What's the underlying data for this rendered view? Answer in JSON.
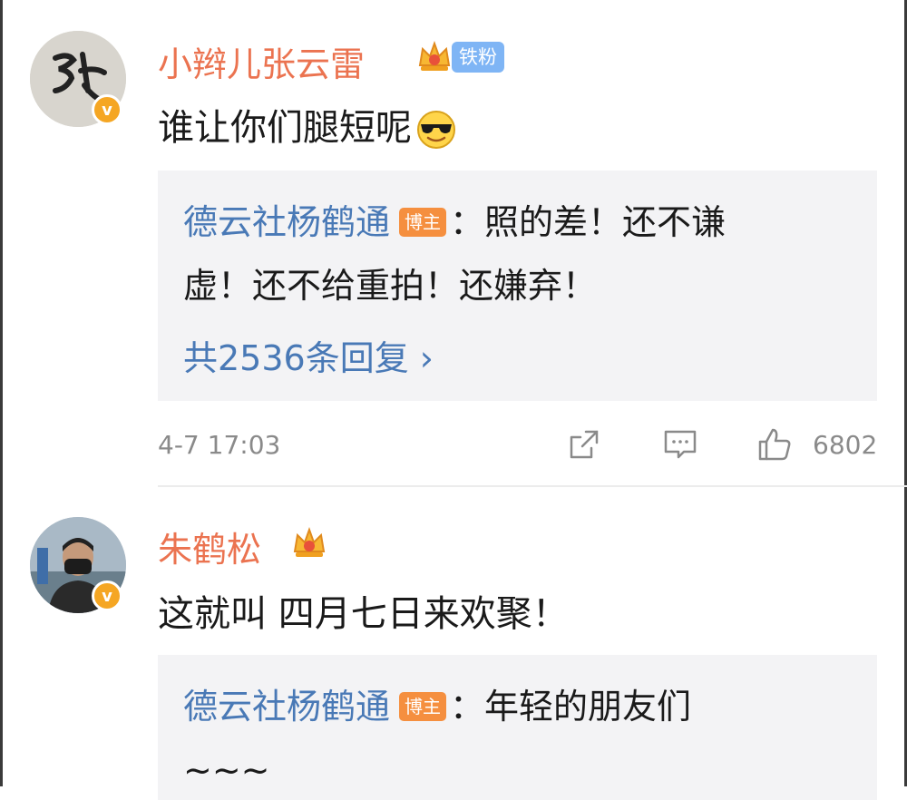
{
  "comments": [
    {
      "username": "小辫儿张云雷",
      "fan_badge": "铁粉",
      "text": "谁让你们腿短呢",
      "emoji": "sunglasses-emoji",
      "reply_preview": {
        "author": "德云社杨鹤通",
        "author_tag": "博主",
        "line1": "：照的差！还不谦",
        "line2": "虚！还不给重拍！还嫌弃！"
      },
      "reply_count_text": "共2536条回复 ›",
      "timestamp": "4-7 17:03",
      "like_count": "6802"
    },
    {
      "username": "朱鹤松",
      "text": "这就叫 四月七日来欢聚！",
      "reply_preview": {
        "author": "德云社杨鹤通",
        "author_tag": "博主",
        "line1": "：年轻的朋友们",
        "line2": "~~~"
      }
    }
  ],
  "colors": {
    "username": "#eb7350",
    "link": "#4979b6",
    "reply_bg": "#f3f3f5",
    "meta_text": "#8a8a8a",
    "verified_badge": "#f5a623"
  }
}
